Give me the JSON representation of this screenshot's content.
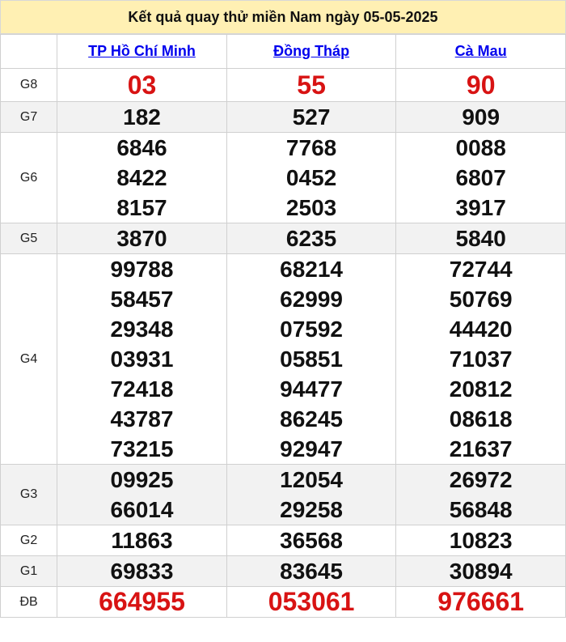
{
  "title": "Kết quả quay thử miền Nam ngày 05-05-2025",
  "colors": {
    "header_bg": "#fff0b3",
    "link": "#0000ee",
    "highlight": "#d81313",
    "alt_row": "#f2f2f2"
  },
  "provinces": [
    "TP Hồ Chí Minh",
    "Đồng Tháp",
    "Cà Mau"
  ],
  "rows": [
    {
      "label": "G8",
      "values": [
        [
          "03"
        ],
        [
          "55"
        ],
        [
          "90"
        ]
      ],
      "red": true
    },
    {
      "label": "G7",
      "values": [
        [
          "182"
        ],
        [
          "527"
        ],
        [
          "909"
        ]
      ]
    },
    {
      "label": "G6",
      "values": [
        [
          "6846",
          "8422",
          "8157"
        ],
        [
          "7768",
          "0452",
          "2503"
        ],
        [
          "0088",
          "6807",
          "3917"
        ]
      ]
    },
    {
      "label": "G5",
      "values": [
        [
          "3870"
        ],
        [
          "6235"
        ],
        [
          "5840"
        ]
      ]
    },
    {
      "label": "G4",
      "values": [
        [
          "99788",
          "58457",
          "29348",
          "03931",
          "72418",
          "43787",
          "73215"
        ],
        [
          "68214",
          "62999",
          "07592",
          "05851",
          "94477",
          "86245",
          "92947"
        ],
        [
          "72744",
          "50769",
          "44420",
          "71037",
          "20812",
          "08618",
          "21637"
        ]
      ]
    },
    {
      "label": "G3",
      "values": [
        [
          "09925",
          "66014"
        ],
        [
          "12054",
          "29258"
        ],
        [
          "26972",
          "56848"
        ]
      ]
    },
    {
      "label": "G2",
      "values": [
        [
          "11863"
        ],
        [
          "36568"
        ],
        [
          "10823"
        ]
      ]
    },
    {
      "label": "G1",
      "values": [
        [
          "69833"
        ],
        [
          "83645"
        ],
        [
          "30894"
        ]
      ]
    },
    {
      "label": "ĐB",
      "values": [
        [
          "664955"
        ],
        [
          "053061"
        ],
        [
          "976661"
        ]
      ],
      "red": true
    }
  ]
}
